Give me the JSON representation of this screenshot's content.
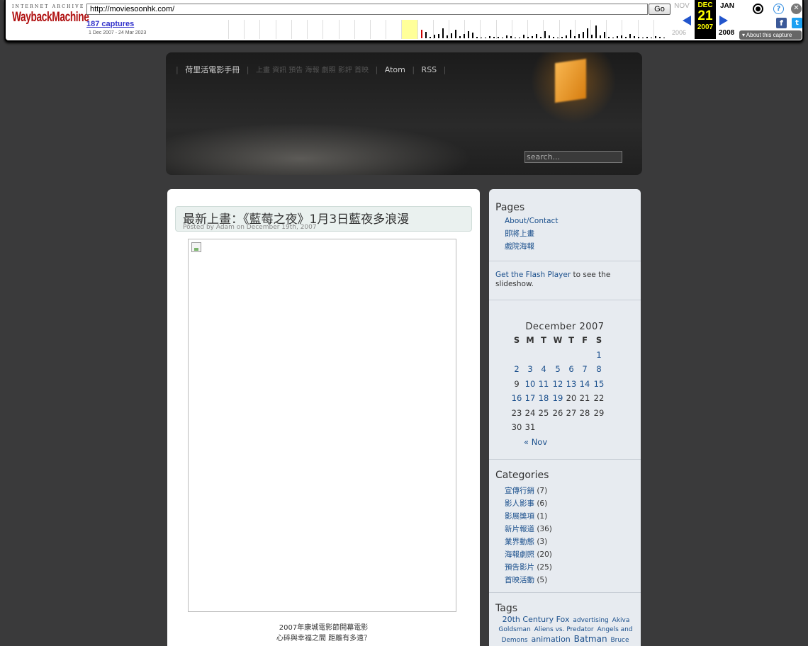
{
  "wayback": {
    "logo_top": "INTERNET ARCHIVE",
    "logo_main": "WaybackMachine",
    "url": "http://moviesoonhk.com/",
    "go_label": "Go",
    "captures": "187 captures",
    "range": "1 Dec 2007 - 24 Mar 2023",
    "prev_month": "NOV",
    "current_month": "DEC",
    "current_day": "21",
    "current_year": "2007",
    "next_month": "JAN",
    "prev_year": "2006",
    "next_year": "2008",
    "about": "About this capture",
    "colors": {
      "accent_blue": "#2255cc",
      "highlight_yellow": "#ffff00"
    },
    "icons": [
      "user-icon",
      "help-icon",
      "close-icon",
      "facebook-icon",
      "twitter-icon"
    ]
  },
  "header": {
    "nav": {
      "home": "荷里活電影手冊",
      "section_sub": "上畫 資訊 預告 海報 劇照 影評 首映",
      "atom": "Atom",
      "rss": "RSS"
    },
    "search_placeholder": "search..."
  },
  "post": {
    "title": "最新上畫：《藍莓之夜》1月3日藍夜多浪漫",
    "meta": "Posted by Adam on December 19th, 2007",
    "caption_line1": "2007年康城電影節開幕電影",
    "caption_line2": "心碎與幸福之間 距離有多遠？"
  },
  "sidebar": {
    "pages_title": "Pages",
    "pages": [
      "About/Contact",
      "即將上畫",
      "戲院海報"
    ],
    "flash_link": "Get the Flash Player",
    "flash_text": " to see the slideshow.",
    "calendar": {
      "caption": "December 2007",
      "weekdays": [
        "S",
        "M",
        "T",
        "W",
        "T",
        "F",
        "S"
      ],
      "days": [
        "1",
        "2",
        "3",
        "4",
        "5",
        "6",
        "7",
        "8",
        "9",
        "10",
        "11",
        "12",
        "13",
        "14",
        "15",
        "16",
        "17",
        "18",
        "19",
        "20",
        "21",
        "22",
        "23",
        "24",
        "25",
        "26",
        "27",
        "28",
        "29",
        "30",
        "31"
      ],
      "linked_days": [
        1,
        2,
        3,
        4,
        5,
        6,
        7,
        8,
        10,
        11,
        12,
        13,
        14,
        15,
        16,
        17,
        18,
        19
      ],
      "prev": "« Nov"
    },
    "categories_title": "Categories",
    "categories": [
      {
        "name": "宣傳行銷",
        "count": "(7)"
      },
      {
        "name": "影人影事",
        "count": "(6)"
      },
      {
        "name": "影展獎項",
        "count": "(1)"
      },
      {
        "name": "新片報道",
        "count": "(36)"
      },
      {
        "name": "業界動態",
        "count": "(3)"
      },
      {
        "name": "海報劇照",
        "count": "(20)"
      },
      {
        "name": "預告影片",
        "count": "(25)"
      },
      {
        "name": "首映活動",
        "count": "(5)"
      }
    ],
    "tags_title": "Tags",
    "tags": [
      {
        "text": "20th Century Fox",
        "size": "md"
      },
      {
        "text": "advertising",
        "size": "sm"
      },
      {
        "text": "Akiva Goldsman",
        "size": "sm"
      },
      {
        "text": "Aliens vs. Predator",
        "size": "sm"
      },
      {
        "text": "Angels and Demons",
        "size": "sm"
      },
      {
        "text": "animation",
        "size": "md"
      },
      {
        "text": "Batman",
        "size": "lg"
      },
      {
        "text": "Bruce",
        "size": "sm"
      }
    ]
  }
}
